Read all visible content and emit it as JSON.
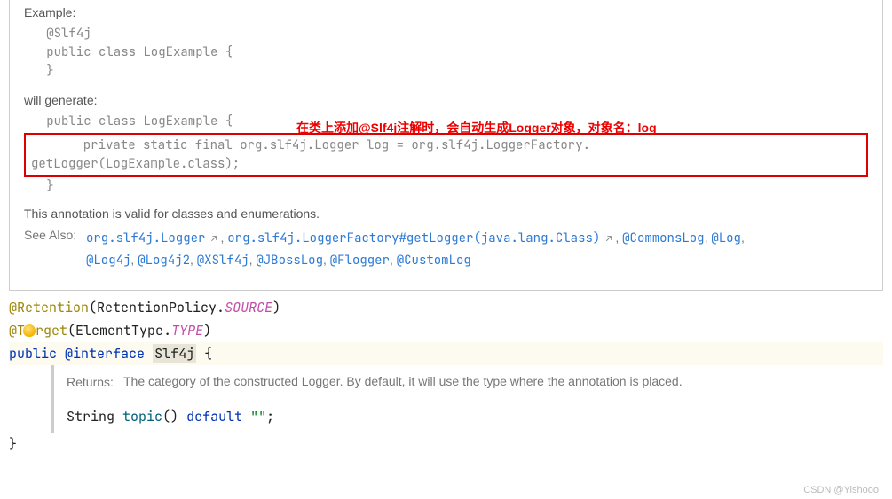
{
  "doc": {
    "example_label": "Example:",
    "example_code": "   @Slf4j\n   public class LogExample {\n   }",
    "generate_label": "will generate:",
    "gen_line1": "   public class LogExample {",
    "gen_boxed": "       private static final org.slf4j.Logger log = org.slf4j.LoggerFactory.\ngetLogger(LogExample.class);",
    "gen_line3": "   }",
    "red_note": "在类上添加@Slf4j注解时，会自动生成Logger对象，对象名：log",
    "valid_text": "This annotation is valid for classes and enumerations.",
    "see_also": "See Also:",
    "links": {
      "logger": "org.slf4j.Logger",
      "factory": "org.slf4j.LoggerFactory#getLogger(java.lang.Class)",
      "commons": "@CommonsLog",
      "log": "@Log",
      "log4j": "@Log4j",
      "log4j2": "@Log4j2",
      "xslf4j": "@XSlf4j",
      "jboss": "@JBossLog",
      "flogger": "@Flogger",
      "custom": "@CustomLog"
    }
  },
  "code": {
    "retention_at": "@Retention",
    "retention_policy": "RetentionPolicy",
    "source": "SOURCE",
    "target_at": "@Target",
    "element_type": "ElementType",
    "type_val": "TYPE",
    "public": "public",
    "at_interface": "@interface",
    "classname": "Slf4j",
    "lbrace": "{",
    "rbrace": "}"
  },
  "returns": {
    "label": "Returns:",
    "text": "The category of the constructed Logger. By default, it will use the type where the annotation is placed.",
    "string_type": "String",
    "method": "topic",
    "default_kw": "default",
    "default_val": "\"\"",
    "semi": ";"
  },
  "watermark": "CSDN @Yishooo."
}
